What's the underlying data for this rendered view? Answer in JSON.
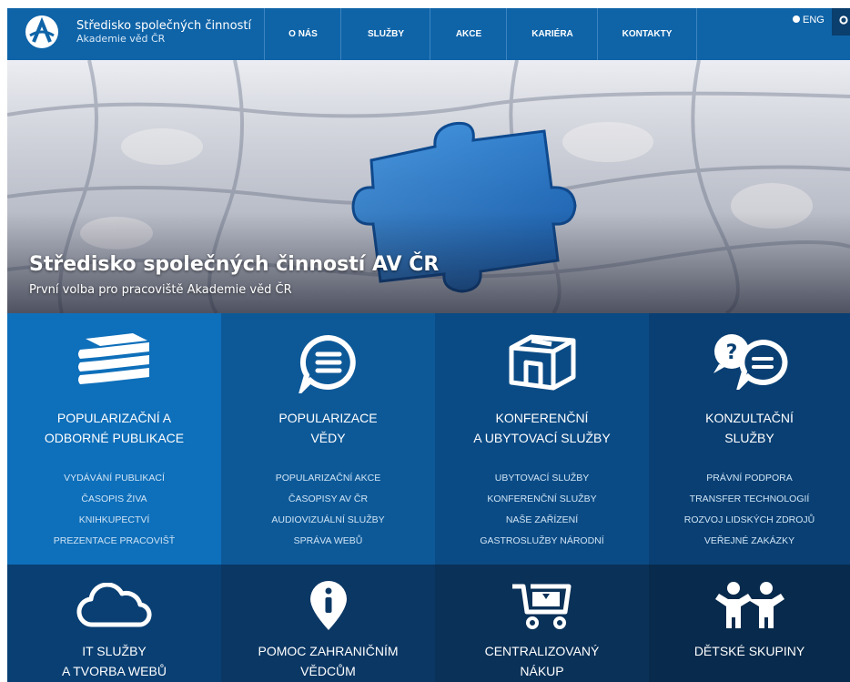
{
  "header": {
    "org_name": "Středisko společných činností",
    "org_sub": "Akademie věd ČR",
    "nav": [
      "O NÁS",
      "SLUŽBY",
      "AKCE",
      "KARIÉRA",
      "KONTAKTY"
    ],
    "lang": "ENG"
  },
  "hero": {
    "title": "Středisko společných činností AV ČR",
    "subtitle": "První volba pro pracoviště Akademie věd ČR"
  },
  "tiles": [
    {
      "title": [
        "POPULARIZAČNÍ A",
        "ODBORNÉ PUBLIKACE"
      ],
      "icon": "books-icon",
      "links": [
        "VYDÁVÁNÍ PUBLIKACÍ",
        "ČASOPIS ŽIVA",
        "KNIHKUPECTVÍ",
        "PREZENTACE PRACOVIŠŤ"
      ]
    },
    {
      "title": [
        "POPULARIZACE",
        "VĚDY"
      ],
      "icon": "speech-bubble-icon",
      "links": [
        "POPULARIZAČNÍ AKCE",
        "ČASOPISY AV ČR",
        "AUDIOVIZUÁLNÍ SLUŽBY",
        "SPRÁVA WEBŮ"
      ]
    },
    {
      "title": [
        "KONFERENČNÍ",
        "A UBYTOVACÍ SLUŽBY"
      ],
      "icon": "building-box-icon",
      "links": [
        "UBYTOVACÍ SLUŽBY",
        "KONFERENČNÍ SLUŽBY",
        "NAŠE ZAŘÍZENÍ",
        "GASTROSLUŽBY NÁRODNÍ"
      ]
    },
    {
      "title": [
        "KONZULTAČNÍ",
        "SLUŽBY"
      ],
      "icon": "question-chat-icon",
      "links": [
        "PRÁVNÍ PODPORA",
        "TRANSFER TECHNOLOGIÍ",
        "ROZVOJ LIDSKÝCH ZDROJŮ",
        "VEŘEJNÉ ZAKÁZKY"
      ]
    },
    {
      "title": [
        "IT SLUŽBY",
        "A TVORBA WEBŮ"
      ],
      "icon": "cloud-icon",
      "links": []
    },
    {
      "title": [
        "POMOC ZAHRANIČNÍM",
        "VĚDCŮM"
      ],
      "icon": "info-pin-icon",
      "links": []
    },
    {
      "title": [
        "CENTRALIZOVANÝ",
        "NÁKUP"
      ],
      "icon": "shopping-cart-icon",
      "links": []
    },
    {
      "title": [
        "DĚTSKÉ SKUPINY"
      ],
      "icon": "children-icon",
      "links": []
    }
  ],
  "colors": {
    "topbar": "#0f64a8",
    "tile_row1": [
      "#0e6fba",
      "#0d5998",
      "#0b4b85",
      "#093f73"
    ],
    "tile_row2": [
      "#093f73",
      "#0b3764",
      "#0a3158",
      "#082a4c"
    ],
    "accent_piece": "#2f86dc"
  }
}
